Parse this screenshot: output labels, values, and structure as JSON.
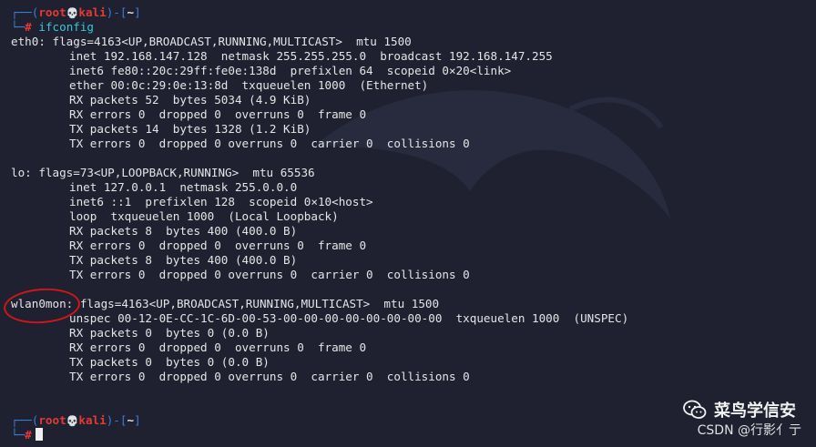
{
  "prompt": {
    "user": "root",
    "host": "kali",
    "path": "~",
    "skull": "💀"
  },
  "command": "ifconfig",
  "lines": [
    "eth0: flags=4163<UP,BROADCAST,RUNNING,MULTICAST>  mtu 1500",
    "inet 192.168.147.128  netmask 255.255.255.0  broadcast 192.168.147.255",
    "inet6 fe80::20c:29ff:fe0e:138d  prefixlen 64  scopeid 0×20<link>",
    "ether 00:0c:29:0e:13:8d  txqueuelen 1000  (Ethernet)",
    "RX packets 52  bytes 5034 (4.9 KiB)",
    "RX errors 0  dropped 0  overruns 0  frame 0",
    "TX packets 14  bytes 1328 (1.2 KiB)",
    "TX errors 0  dropped 0 overruns 0  carrier 0  collisions 0",
    "lo: flags=73<UP,LOOPBACK,RUNNING>  mtu 65536",
    "inet 127.0.0.1  netmask 255.0.0.0",
    "inet6 ::1  prefixlen 128  scopeid 0×10<host>",
    "loop  txqueuelen 1000  (Local Loopback)",
    "RX packets 8  bytes 400 (400.0 B)",
    "RX errors 0  dropped 0  overruns 0  frame 0",
    "TX packets 8  bytes 400 (400.0 B)",
    "TX errors 0  dropped 0 overruns 0  carrier 0  collisions 0",
    "wlan0mon: flags=4163<UP,BROADCAST,RUNNING,MULTICAST>  mtu 1500",
    "unspec 00-12-0E-CC-1C-6D-00-53-00-00-00-00-00-00-00-00  txqueuelen 1000  (UNSPEC)",
    "RX packets 0  bytes 0 (0.0 B)",
    "RX errors 0  dropped 0  overruns 0  frame 0",
    "TX packets 0  bytes 0 (0.0 B)",
    "TX errors 0  dropped 0 overruns 0  carrier 0  collisions 0"
  ],
  "watermark": {
    "brand": "菜鸟学信安",
    "csdn": "CSDN @行影亻亍"
  },
  "colors": {
    "prompt_frame": "#3d7bd9",
    "prompt_user": "#e53935",
    "command": "#39c7d6",
    "highlight_circle": "#d11616"
  }
}
